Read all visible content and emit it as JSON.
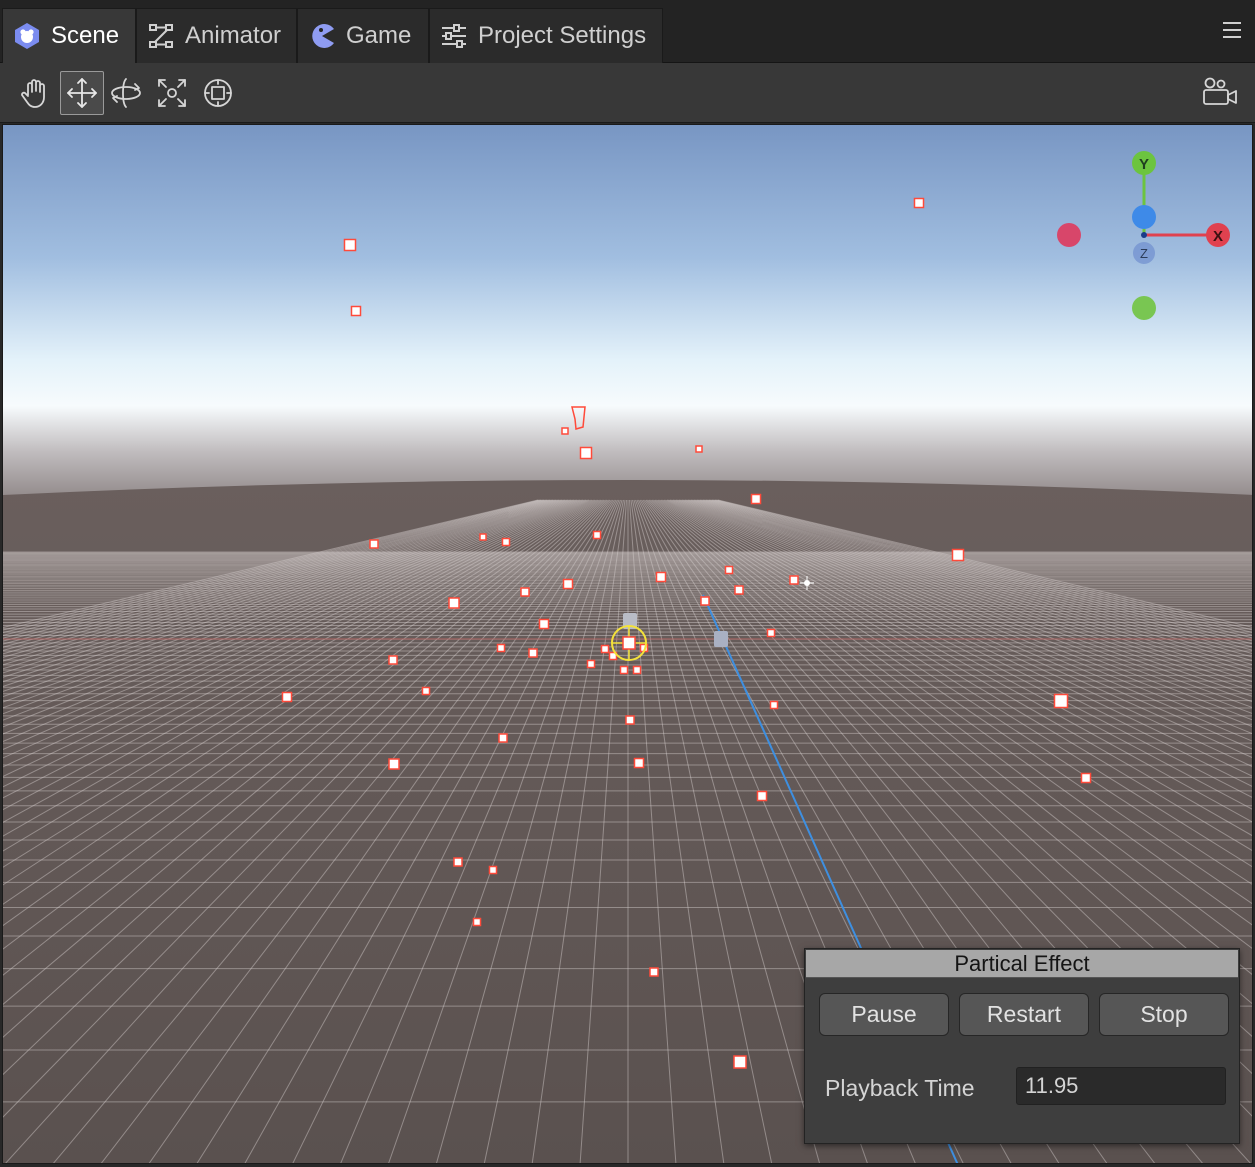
{
  "tabs": [
    {
      "label": "Scene",
      "icon": "unity-scene-icon",
      "active": true
    },
    {
      "label": "Animator",
      "icon": "animator-icon",
      "active": false
    },
    {
      "label": "Game",
      "icon": "game-pacman-icon",
      "active": false
    },
    {
      "label": "Project Settings",
      "icon": "sliders-icon",
      "active": false
    }
  ],
  "menu_icon": "hamburger-menu-icon",
  "toolbar": {
    "tools": [
      "hand-tool-icon",
      "move-tool-icon",
      "rotate-tool-icon",
      "scale-tool-icon",
      "rect-tool-icon"
    ],
    "active_tool": "move-tool-icon",
    "camera_icon": "scene-camera-icon"
  },
  "gizmo": {
    "x_label": "X",
    "y_label": "Y",
    "z_label": "Z"
  },
  "colors": {
    "x_axis": "#e0414f",
    "y_axis": "#6cc43f",
    "z_axis": "#3e8ae8",
    "particle": "#ff4a3a"
  },
  "panel": {
    "title": "Partical Effect",
    "pause_label": "Pause",
    "restart_label": "Restart",
    "stop_label": "Stop",
    "playback_label": "Playback Time",
    "playback_value": "11.95"
  }
}
